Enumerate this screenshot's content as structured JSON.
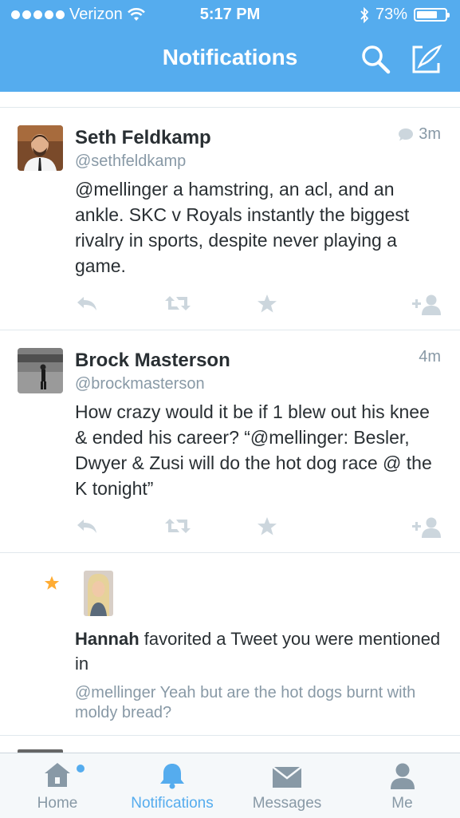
{
  "status_bar": {
    "carrier": "Verizon",
    "time": "5:17 PM",
    "battery": "73%",
    "battery_level": 0.73
  },
  "header": {
    "title": "Notifications",
    "search_icon": "search-icon",
    "compose_icon": "compose-icon"
  },
  "tweets": [
    {
      "name": "Seth Feldkamp",
      "handle": "@sethfeldkamp",
      "time": "3m",
      "has_reply_indicator": true,
      "text": "@mellinger a hamstring, an acl, and an ankle.  SKC v Royals instantly the biggest rivalry in sports, despite never playing a game."
    },
    {
      "name": "Brock Masterson",
      "handle": "@brockmasterson",
      "time": "4m",
      "has_reply_indicator": false,
      "text": "How crazy would it be if 1 blew out his knee & ended his career? “@mellinger: Besler, Dwyer & Zusi will do the hot dog race @ the K tonight”"
    }
  ],
  "favorite_notification": {
    "user": "Hannah",
    "action": " favorited a Tweet you were mentioned in",
    "quoted_text": "@mellinger Yeah but are the hot dogs burnt with moldy bread?"
  },
  "tabs": [
    {
      "label": "Home",
      "icon": "home-icon",
      "active": false,
      "badge": true
    },
    {
      "label": "Notifications",
      "icon": "bell-icon",
      "active": true,
      "badge": false
    },
    {
      "label": "Messages",
      "icon": "envelope-icon",
      "active": false,
      "badge": false
    },
    {
      "label": "Me",
      "icon": "person-icon",
      "active": false,
      "badge": false
    }
  ],
  "colors": {
    "brand_blue": "#55acee",
    "muted_gray": "#8899a6",
    "action_gray": "#ccd6dd",
    "star_gold": "#ffac33"
  }
}
